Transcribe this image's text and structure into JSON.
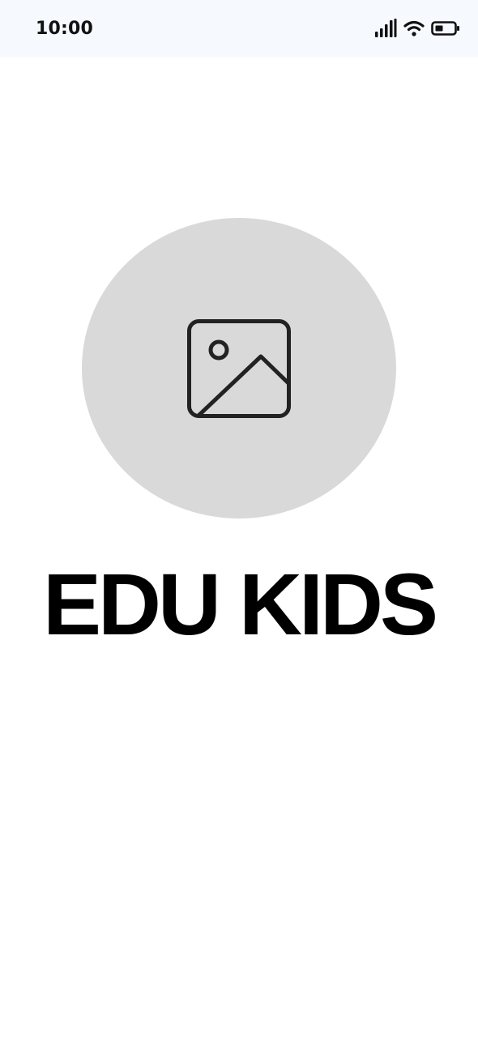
{
  "status_bar": {
    "time": "10:00",
    "icons": [
      "cellular-signal-icon",
      "wifi-icon",
      "battery-icon"
    ]
  },
  "logo": {
    "icon": "image-placeholder-icon",
    "background_color": "#d9d9d9"
  },
  "app": {
    "title": "EDU KIDS"
  }
}
